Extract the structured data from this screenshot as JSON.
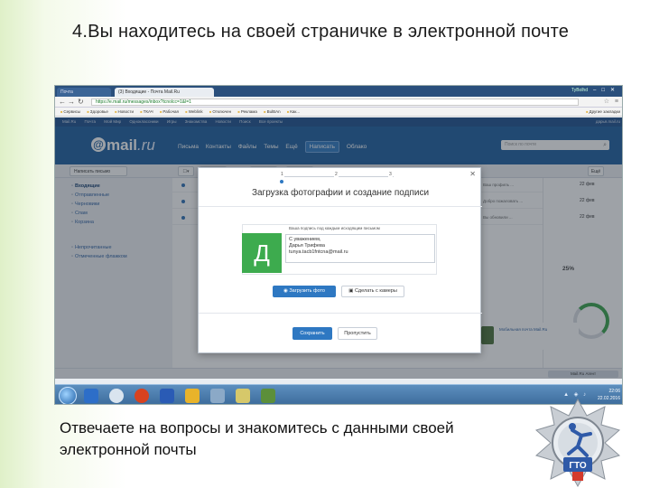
{
  "slide": {
    "title": "4.Вы находитесь на  своей  страничке в электронной почте",
    "caption": "Отвечаете на вопросы и знакомитесь с данными своей электронной почты"
  },
  "browser": {
    "tab1": "Почта",
    "tab2": "(3) Входящие - Почта Mail.Ru",
    "user": "TyBolhd",
    "url": "https://e.mail.ru/messages/inbox?tcnolcc=1&l=1",
    "bookmarks": [
      "Сервисы",
      "Здоровье",
      "Новости",
      "ТКАЧ",
      "Рабочая",
      "Weblink",
      "Отключен",
      "Реклама",
      "BulBAn",
      "Как..."
    ],
    "bookmarks_right": "Другие закладки"
  },
  "mail": {
    "topnav": [
      "Mail.Ru",
      "Почта",
      "Мой Мир",
      "Одноклассники",
      "Игры",
      "Знакомства",
      "Новости",
      "Поиск",
      "Все проекты"
    ],
    "topnav_user": "дарья.mail.ru",
    "logo_at": "@",
    "logo_mail": "mail",
    "logo_ru": ".ru",
    "tabs": [
      "Письма",
      "Контакты",
      "Файлы",
      "Темы",
      "Ещё"
    ],
    "write": "Написать",
    "cloud": "Облако",
    "search_placeholder": "Поиск по почте",
    "write_letter": "Написать письмо",
    "more": "Ещё",
    "folders": [
      "Входящие",
      "Отправленные",
      "Черновики",
      "Спам",
      "Корзина"
    ],
    "folders2": [
      "Непрочитанные",
      "Отмеченные флажком"
    ],
    "messages": [
      {
        "snippet": "Ваш профиль ...",
        "date": "22 фев"
      },
      {
        "snippet": "Добро пожаловать ...",
        "date": "22 фев"
      },
      {
        "snippet": "Вы обновили ...",
        "date": "22 фев"
      }
    ],
    "gauge_value": "25%",
    "promo": "Мобильная почта Mail.Ru",
    "agent": "Mail.Ru Агент"
  },
  "modal": {
    "steps": [
      "1",
      "2",
      "3"
    ],
    "title": "Загрузка фотографии и создание подписи",
    "avatar_letter": "Д",
    "sig_label": "Ваша подпись под каждым исходящим письмом",
    "sig_lines": [
      "С уважением,",
      "Дарья Трифева",
      "tunya.tacb1fntcna@mail.ru"
    ],
    "upload": "Загрузить фото",
    "webcam": "Сделать с камеры",
    "save": "Сохранить",
    "later": "Пропустить"
  },
  "taskbar": {
    "time": "22:06",
    "date": "22.02.2016"
  },
  "colors": {
    "mail_blue": "#1d5e9f",
    "accent_green": "#3dab4e",
    "button_blue": "#2e78c2"
  }
}
